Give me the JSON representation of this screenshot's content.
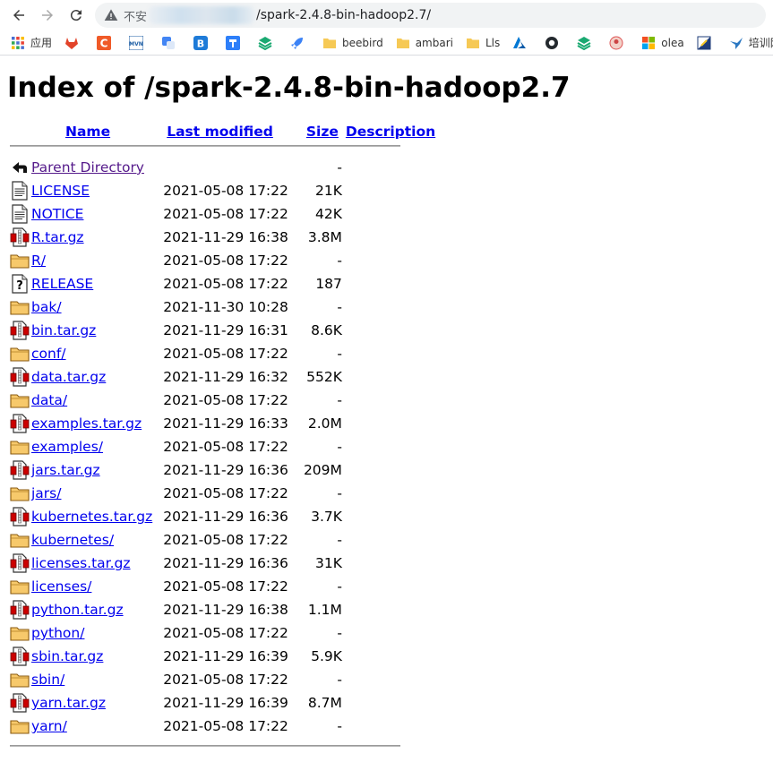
{
  "browser": {
    "address": {
      "insecure_label": "不安",
      "path": "/spark-2.4.8-bin-hadoop2.7/"
    },
    "bookmarks": [
      {
        "icon": "apps-grid-icon",
        "label": "应用"
      },
      {
        "icon": "gitlab-icon",
        "label": ""
      },
      {
        "icon": "c-red-icon",
        "label": ""
      },
      {
        "icon": "mvn-icon",
        "label": ""
      },
      {
        "icon": "translate-icon",
        "label": ""
      },
      {
        "icon": "b-blue-icon",
        "label": ""
      },
      {
        "icon": "tool-icon",
        "label": ""
      },
      {
        "icon": "stack-green-icon",
        "label": ""
      },
      {
        "icon": "rocket-icon",
        "label": ""
      },
      {
        "icon": "folder-icon",
        "label": "beebird"
      },
      {
        "icon": "folder-icon",
        "label": "ambari"
      },
      {
        "icon": "folder-icon",
        "label": "Lls"
      },
      {
        "icon": "azure-icon",
        "label": ""
      },
      {
        "icon": "github-icon",
        "label": ""
      },
      {
        "icon": "stack-green-icon",
        "label": ""
      },
      {
        "icon": "avatar-icon",
        "label": ""
      },
      {
        "icon": "windows-icon",
        "label": "olea"
      },
      {
        "icon": "flag-icon",
        "label": ""
      },
      {
        "icon": "bird-icon",
        "label": "培训网页"
      }
    ]
  },
  "page": {
    "title": "Index of /spark-2.4.8-bin-hadoop2.7",
    "columns": {
      "name": "Name",
      "modified": "Last modified",
      "size": "Size",
      "description": "Description"
    },
    "rows": [
      {
        "icon": "back-icon",
        "name": "Parent Directory",
        "modified": "",
        "size": "-",
        "visited": true
      },
      {
        "icon": "text-file-icon",
        "name": "LICENSE",
        "modified": "2021-05-08 17:22",
        "size": "21K"
      },
      {
        "icon": "text-file-icon",
        "name": "NOTICE",
        "modified": "2021-05-08 17:22",
        "size": "42K"
      },
      {
        "icon": "archive-icon",
        "name": "R.tar.gz",
        "modified": "2021-11-29 16:38",
        "size": "3.8M"
      },
      {
        "icon": "folder-icon",
        "name": "R/",
        "modified": "2021-05-08 17:22",
        "size": "-"
      },
      {
        "icon": "unknown-file-icon",
        "name": "RELEASE",
        "modified": "2021-05-08 17:22",
        "size": "187"
      },
      {
        "icon": "folder-icon",
        "name": "bak/",
        "modified": "2021-11-30 10:28",
        "size": "-"
      },
      {
        "icon": "archive-icon",
        "name": "bin.tar.gz",
        "modified": "2021-11-29 16:31",
        "size": "8.6K"
      },
      {
        "icon": "folder-icon",
        "name": "conf/",
        "modified": "2021-05-08 17:22",
        "size": "-"
      },
      {
        "icon": "archive-icon",
        "name": "data.tar.gz",
        "modified": "2021-11-29 16:32",
        "size": "552K"
      },
      {
        "icon": "folder-icon",
        "name": "data/",
        "modified": "2021-05-08 17:22",
        "size": "-"
      },
      {
        "icon": "archive-icon",
        "name": "examples.tar.gz",
        "modified": "2021-11-29 16:33",
        "size": "2.0M"
      },
      {
        "icon": "folder-icon",
        "name": "examples/",
        "modified": "2021-05-08 17:22",
        "size": "-"
      },
      {
        "icon": "archive-icon",
        "name": "jars.tar.gz",
        "modified": "2021-11-29 16:36",
        "size": "209M"
      },
      {
        "icon": "folder-icon",
        "name": "jars/",
        "modified": "2021-05-08 17:22",
        "size": "-"
      },
      {
        "icon": "archive-icon",
        "name": "kubernetes.tar.gz",
        "modified": "2021-11-29 16:36",
        "size": "3.7K"
      },
      {
        "icon": "folder-icon",
        "name": "kubernetes/",
        "modified": "2021-05-08 17:22",
        "size": "-"
      },
      {
        "icon": "archive-icon",
        "name": "licenses.tar.gz",
        "modified": "2021-11-29 16:36",
        "size": "31K"
      },
      {
        "icon": "folder-icon",
        "name": "licenses/",
        "modified": "2021-05-08 17:22",
        "size": "-"
      },
      {
        "icon": "archive-icon",
        "name": "python.tar.gz",
        "modified": "2021-11-29 16:38",
        "size": "1.1M"
      },
      {
        "icon": "folder-icon",
        "name": "python/",
        "modified": "2021-05-08 17:22",
        "size": "-"
      },
      {
        "icon": "archive-icon",
        "name": "sbin.tar.gz",
        "modified": "2021-11-29 16:39",
        "size": "5.9K"
      },
      {
        "icon": "folder-icon",
        "name": "sbin/",
        "modified": "2021-05-08 17:22",
        "size": "-"
      },
      {
        "icon": "archive-icon",
        "name": "yarn.tar.gz",
        "modified": "2021-11-29 16:39",
        "size": "8.7M"
      },
      {
        "icon": "folder-icon",
        "name": "yarn/",
        "modified": "2021-05-08 17:22",
        "size": "-"
      }
    ]
  }
}
